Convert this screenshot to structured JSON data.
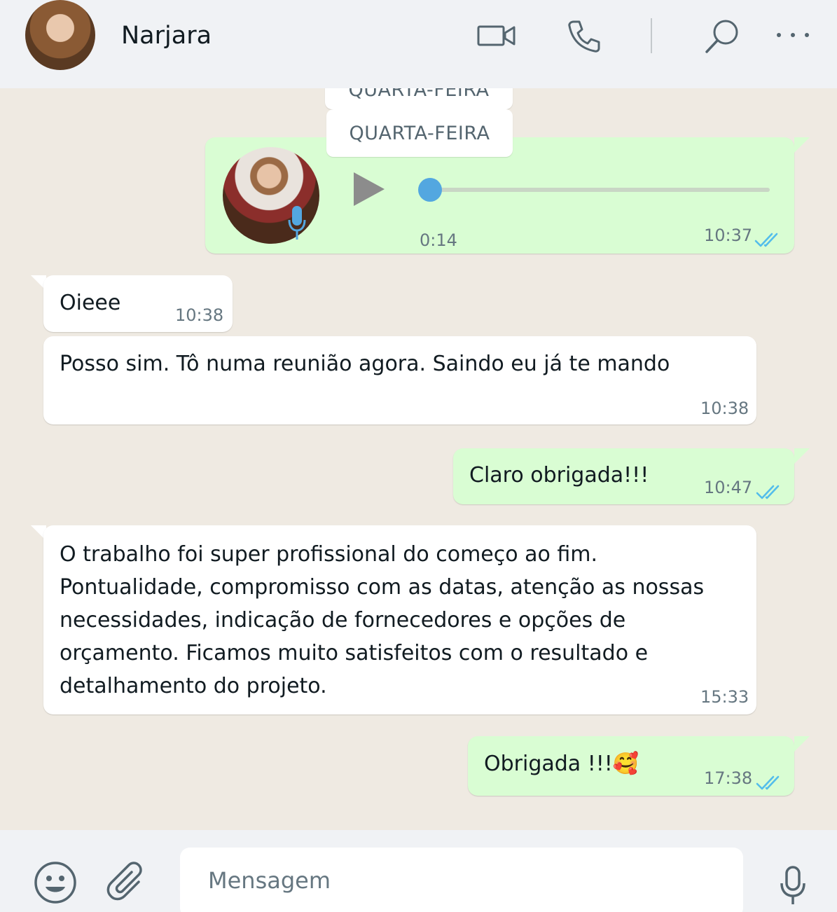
{
  "header": {
    "contact_name": "Narjara",
    "icons": [
      "video-call-icon",
      "voice-call-icon",
      "search-icon",
      "more-options-icon"
    ]
  },
  "chat": {
    "date_labels": [
      "QUARTA-FEIRA",
      "QUARTA-FEIRA"
    ],
    "voice_message": {
      "duration": "0:14",
      "time": "10:37",
      "status": "read",
      "progress": 0.0
    },
    "messages": [
      {
        "direction": "in",
        "text": "Oieee",
        "time": "10:38"
      },
      {
        "direction": "in",
        "text": "Posso sim. Tô numa reunião agora. Saindo eu já te mando",
        "time": "10:38"
      },
      {
        "direction": "out",
        "text": "Claro obrigada!!!",
        "time": "10:47",
        "status": "read"
      },
      {
        "direction": "in",
        "lines": [
          "O trabalho foi super profissional do começo ao fim.",
          "Pontualidade, compromisso com as datas, atenção as nossas",
          "necessidades, indicação de fornecedores e opções de",
          "orçamento. Ficamos muito satisfeitos com o resultado e",
          "detalhamento do projeto."
        ],
        "time": "15:33"
      },
      {
        "direction": "out",
        "text": "Obrigada !!!",
        "emoji": "🥰",
        "time": "17:38",
        "status": "read"
      }
    ]
  },
  "footer": {
    "placeholder": "Mensagem",
    "icons": [
      "emoji-icon",
      "attach-icon",
      "microphone-icon"
    ]
  },
  "colors": {
    "outgoing_bubble": "#d9fdd3",
    "incoming_bubble": "#ffffff",
    "read_ticks": "#53bdeb",
    "chat_background": "#efeae2",
    "bar_background": "#f0f2f5"
  }
}
